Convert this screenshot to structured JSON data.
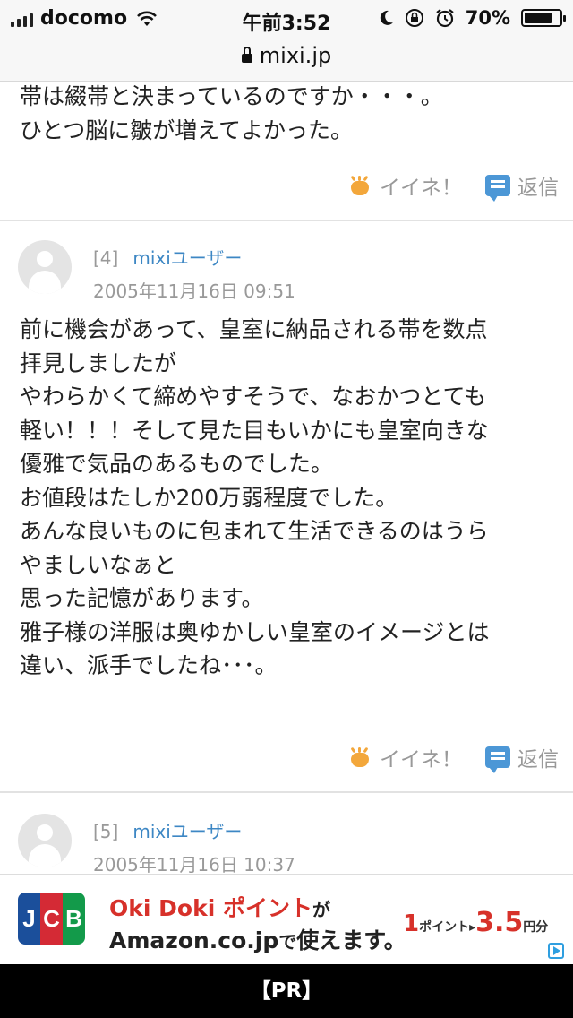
{
  "status_bar": {
    "carrier": "docomo",
    "time": "午前3:52",
    "battery": "70%"
  },
  "url_bar": {
    "domain": "mixi.jp"
  },
  "comments": [
    {
      "text": "帯は綴帯と決まっているのですか・・・。\nひとつ脳に皺が増えてよかった。",
      "like_label": "イイネ！",
      "reply_label": "返信"
    },
    {
      "number": "[4]",
      "user": "mixiユーザー",
      "date": "2005年11月16日 09:51",
      "text": "前に機会があって、皇室に納品される帯を数点\n拝見しましたが\nやわらかくて締めやすそうで、なおかつとても\n軽い！！！そして見た目もいかにも皇室向きな\n優雅で気品のあるものでした。\nお値段はたしか200万弱程度でした。\nあんな良いものに包まれて生活できるのはうら\nやましいなぁと\n思った記憶があります。\n雅子様の洋服は奥ゆかしい皇室のイメージとは\n違い、派手でしたね･･･。",
      "like_label": "イイネ！",
      "reply_label": "返信"
    },
    {
      "number": "[5]",
      "user": "mixiユーザー",
      "date": "2005年11月16日 10:37"
    }
  ],
  "ad": {
    "logo_letters": [
      "J",
      "C",
      "B"
    ],
    "line1_brand": "Oki Doki ポイント",
    "line1_suffix": "が",
    "line2_main": "Amazon.co.jp",
    "line2_mid": "で",
    "line2_end": "使えます。",
    "rate_from": "1",
    "rate_from_unit": "ポイント",
    "rate_arrow": "▸",
    "rate_to": "3.5",
    "rate_to_unit": "円分"
  },
  "bottom_bar": {
    "label": "【PR】"
  }
}
